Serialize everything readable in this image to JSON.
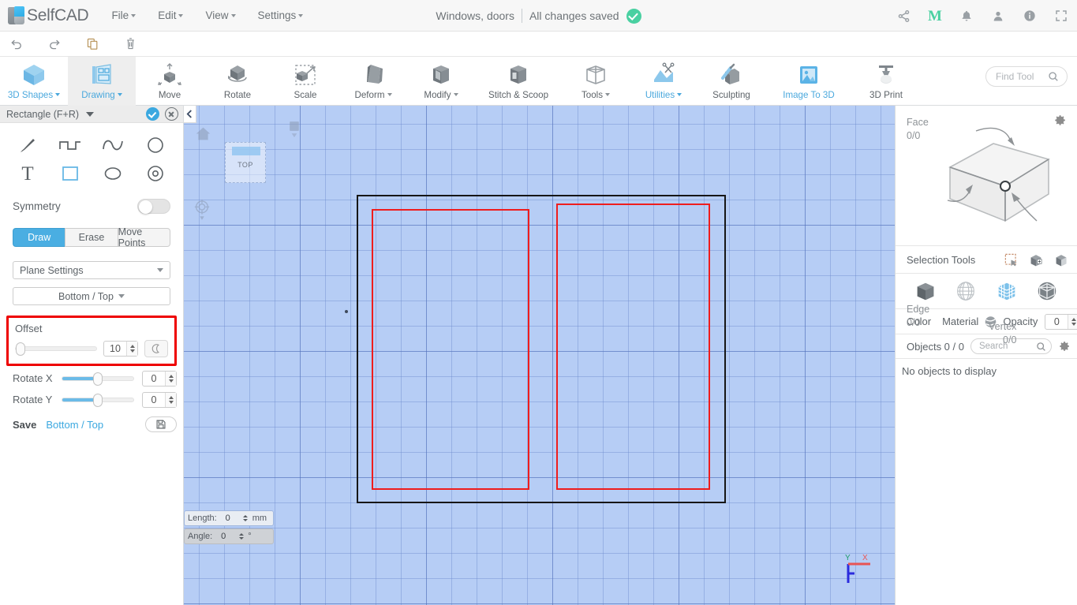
{
  "app": {
    "brand": "SelfCAD",
    "menus": [
      "File",
      "Edit",
      "View",
      "Settings"
    ],
    "doc_title": "Windows, doors",
    "save_status": "All changes saved",
    "account_badge": "M",
    "accent_blue": "#4aa8dd",
    "accent_green": "#49d0a1",
    "highlight_red": "#ee0000"
  },
  "history_bar": {
    "undo": "undo-icon",
    "redo": "redo-icon",
    "copy": "copy-icon",
    "delete": "trash-icon"
  },
  "top_right": {
    "share": "share-icon",
    "notifications": "bell-icon",
    "profile": "person-icon",
    "info": "info-icon",
    "fullscreen": "fullscreen-icon"
  },
  "toolbar": {
    "tools": [
      {
        "label": "3D Shapes",
        "icon": "cube-icon",
        "dropdown": true,
        "active": false,
        "blue": true
      },
      {
        "label": "Drawing",
        "icon": "drawing-icon",
        "dropdown": true,
        "active": true,
        "blue": true
      },
      {
        "label": "Move",
        "icon": "move-icon",
        "dropdown": false,
        "active": false,
        "blue": false
      },
      {
        "label": "Rotate",
        "icon": "rotate-icon",
        "dropdown": false,
        "active": false,
        "blue": false
      },
      {
        "label": "Scale",
        "icon": "scale-icon",
        "dropdown": false,
        "active": false,
        "blue": false
      },
      {
        "label": "Deform",
        "icon": "deform-icon",
        "dropdown": true,
        "active": false,
        "blue": false
      },
      {
        "label": "Modify",
        "icon": "modify-icon",
        "dropdown": true,
        "active": false,
        "blue": false
      },
      {
        "label": "Stitch & Scoop",
        "icon": "stitch-scoop-icon",
        "dropdown": false,
        "active": false,
        "blue": false
      },
      {
        "label": "Tools",
        "icon": "tools-icon",
        "dropdown": true,
        "active": false,
        "blue": false
      },
      {
        "label": "Utilities",
        "icon": "utilities-icon",
        "dropdown": true,
        "active": false,
        "blue": true
      },
      {
        "label": "Sculpting",
        "icon": "sculpting-icon",
        "dropdown": false,
        "active": false,
        "blue": false
      },
      {
        "label": "Image To 3D",
        "icon": "image-to-3d-icon",
        "dropdown": false,
        "active": false,
        "blue": true
      },
      {
        "label": "3D Print",
        "icon": "3d-print-icon",
        "dropdown": false,
        "active": false,
        "blue": false
      }
    ],
    "find_tool_placeholder": "Find Tool"
  },
  "left_panel": {
    "title": "Rectangle (F+R)",
    "confirm": "confirm-button",
    "cancel": "cancel-button",
    "shape_tools": [
      {
        "name": "freehand-brush-tool",
        "glyph": "brush"
      },
      {
        "name": "polyline-tool",
        "glyph": "polyline"
      },
      {
        "name": "curve-tool",
        "glyph": "curve"
      },
      {
        "name": "circle-tool",
        "glyph": "circle"
      },
      {
        "name": "text-tool",
        "glyph": "text"
      },
      {
        "name": "rectangle-tool",
        "glyph": "rectangle"
      },
      {
        "name": "ellipse-tool",
        "glyph": "ellipse"
      },
      {
        "name": "ring-tool",
        "glyph": "ring"
      }
    ],
    "symmetry_label": "Symmetry",
    "symmetry_on": false,
    "modes": [
      {
        "label": "Draw",
        "active": true
      },
      {
        "label": "Erase",
        "active": false
      },
      {
        "label": "Move Points",
        "active": false
      }
    ],
    "plane_settings_label": "Plane Settings",
    "plane_value": "Bottom / Top",
    "offset": {
      "label": "Offset",
      "value": "10",
      "slider_percent": 0,
      "highlighted": true,
      "moon_button": "reset-offset-button"
    },
    "rotate_x": {
      "label": "Rotate X",
      "value": "0",
      "slider_percent": 50
    },
    "rotate_y": {
      "label": "Rotate Y",
      "value": "0",
      "slider_percent": 50
    },
    "save_row": {
      "label": "Save",
      "link": "Bottom / Top",
      "button": "save-plane-button"
    }
  },
  "viewport": {
    "view_cube_label": "TOP",
    "home_icon": "home-icon",
    "cube_view_icon": "cube-view-icon",
    "target_icon": "target-icon",
    "collapse_icon": "chevron-left-icon",
    "background_color": "#b6cdf5",
    "shapes": [
      {
        "name": "outer-rectangle",
        "color": "#161616"
      },
      {
        "name": "inner-rectangle-left",
        "color": "#ef1d1d"
      },
      {
        "name": "inner-rectangle-right",
        "color": "#ef1d1d"
      }
    ],
    "measurements": {
      "length_label": "Length:",
      "length_value": "0",
      "length_unit": "mm",
      "angle_label": "Angle:",
      "angle_value": "0",
      "angle_unit": "°"
    },
    "axis": {
      "x": "X",
      "y": "Y"
    }
  },
  "right_panel": {
    "gear": "settings-gear-icon",
    "face_label": "Face",
    "face_value": "0/0",
    "edge_label": "Edge",
    "edge_value": "0/0",
    "vertex_label": "Vertex",
    "vertex_value": "0/0",
    "selection_tools_label": "Selection Tools",
    "selection_icons": [
      {
        "name": "rect-select-icon"
      },
      {
        "name": "add-select-icon"
      },
      {
        "name": "invert-select-icon"
      }
    ],
    "mode_icons": [
      {
        "name": "object-mode-icon"
      },
      {
        "name": "wireframe-mode-icon"
      },
      {
        "name": "face-mode-icon"
      },
      {
        "name": "vertex-mode-icon"
      }
    ],
    "color_label": "Color",
    "color_value": "#111111",
    "material_label": "Material",
    "opacity_label": "Opacity",
    "opacity_value": "0",
    "objects_label": "Objects 0 / 0",
    "search_placeholder": "Search",
    "objects_gear": "objects-settings-icon",
    "empty_message": "No objects to display"
  }
}
